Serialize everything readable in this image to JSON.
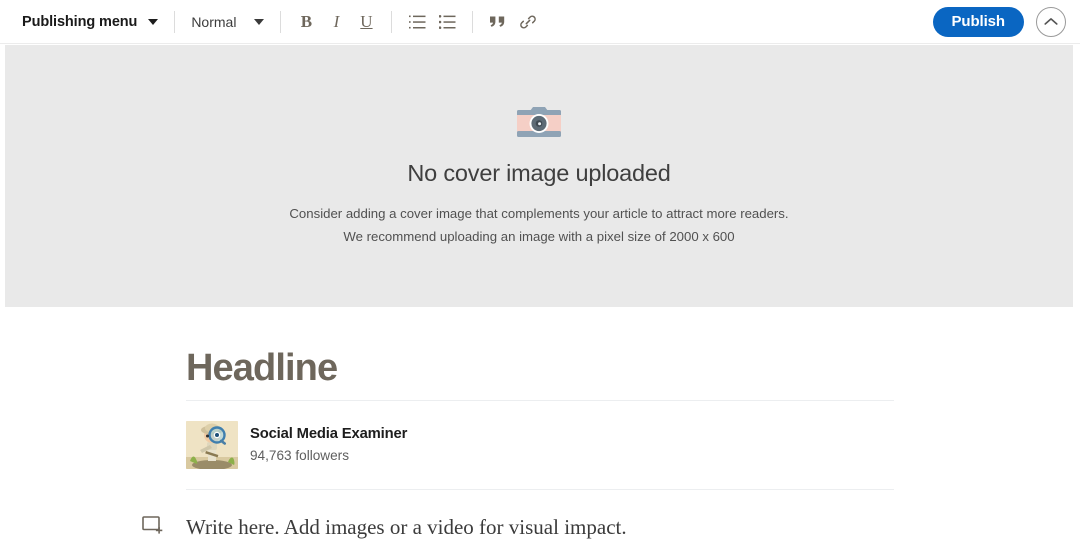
{
  "toolbar": {
    "publishing_menu": {
      "label": "Publishing menu",
      "icon": "chevron-down-icon"
    },
    "text_style": {
      "label": "Normal",
      "icon": "chevron-down-icon"
    },
    "format_buttons": [
      {
        "name": "bold-button",
        "label": "B"
      },
      {
        "name": "italic-button",
        "label": "I"
      },
      {
        "name": "underline-button",
        "label": "U"
      }
    ],
    "list_buttons": [
      {
        "name": "ordered-list-button",
        "icon": "ordered-list-icon"
      },
      {
        "name": "bulleted-list-button",
        "icon": "bulleted-list-icon"
      }
    ],
    "insert_buttons": [
      {
        "name": "blockquote-button",
        "icon": "quote-icon"
      },
      {
        "name": "link-button",
        "icon": "link-icon"
      }
    ],
    "publish_label": "Publish",
    "publish_color": "#0a66c2",
    "collapse_icon": "chevron-up-icon"
  },
  "cover": {
    "icon": "camera-icon",
    "title": "No cover image uploaded",
    "line1": "Consider adding a cover image that complements your article to attract more readers.",
    "line2": "We recommend uploading an image with a pixel size of 2000 x 600",
    "background": "#e9e9e9"
  },
  "article": {
    "headline_placeholder": "Headline",
    "headline_color": "#6e675c",
    "author": {
      "avatar": "explorer-magnifying-glass-avatar",
      "name": "Social Media Examiner",
      "followers": "94,763 followers"
    },
    "body": {
      "insert_icon": "add-content-icon",
      "placeholder": "Write here. Add images or a video for visual impact."
    }
  }
}
